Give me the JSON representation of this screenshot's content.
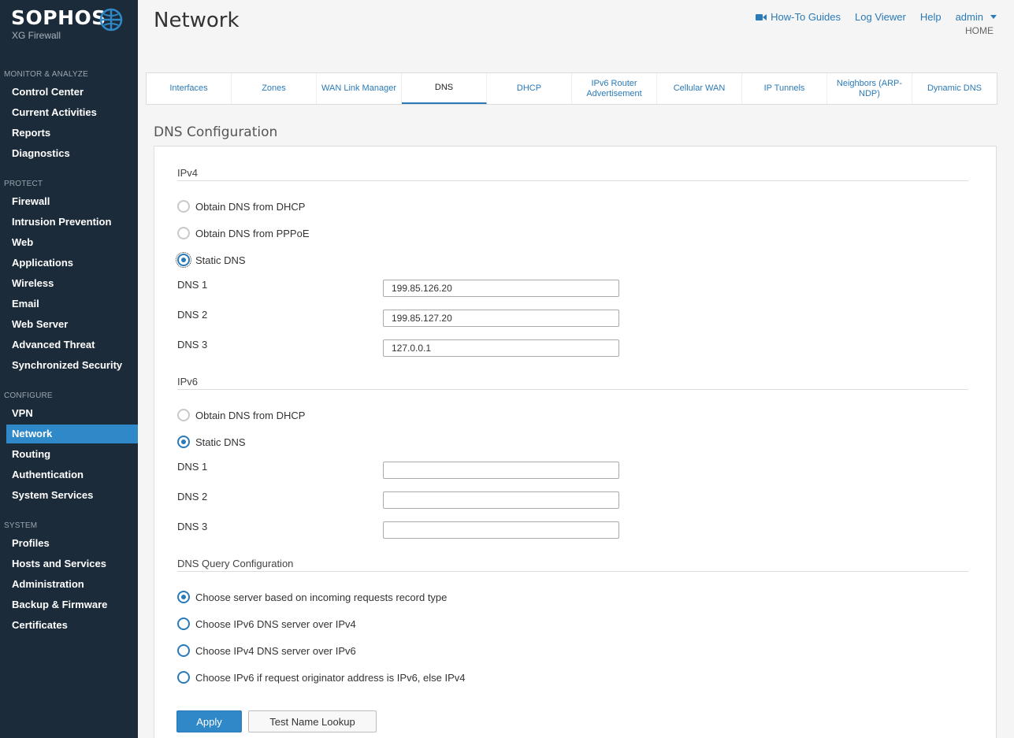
{
  "brand": {
    "name": "SOPHOS",
    "product": "XG Firewall"
  },
  "sidebar": {
    "sections": [
      {
        "label": "MONITOR & ANALYZE",
        "items": [
          "Control Center",
          "Current Activities",
          "Reports",
          "Diagnostics"
        ]
      },
      {
        "label": "PROTECT",
        "items": [
          "Firewall",
          "Intrusion Prevention",
          "Web",
          "Applications",
          "Wireless",
          "Email",
          "Web Server",
          "Advanced Threat",
          "Synchronized Security"
        ]
      },
      {
        "label": "CONFIGURE",
        "items": [
          "VPN",
          "Network",
          "Routing",
          "Authentication",
          "System Services"
        ]
      },
      {
        "label": "SYSTEM",
        "items": [
          "Profiles",
          "Hosts and Services",
          "Administration",
          "Backup & Firmware",
          "Certificates"
        ]
      }
    ],
    "active_item": "Network"
  },
  "header": {
    "title": "Network",
    "links": {
      "howto": "How-To Guides",
      "logviewer": "Log Viewer",
      "help": "Help",
      "user": "admin"
    },
    "breadcrumb": "HOME"
  },
  "tabs": [
    "Interfaces",
    "Zones",
    "WAN Link Manager",
    "DNS",
    "DHCP",
    "IPv6 Router Advertisement",
    "Cellular WAN",
    "IP Tunnels",
    "Neighbors (ARP-NDP)",
    "Dynamic DNS"
  ],
  "active_tab": "DNS",
  "dns": {
    "section_title": "DNS Configuration",
    "ipv4": {
      "title": "IPv4",
      "options": [
        "Obtain DNS from DHCP",
        "Obtain DNS from PPPoE",
        "Static DNS"
      ],
      "selected": "Static DNS",
      "fields": [
        {
          "label": "DNS 1",
          "value": "199.85.126.20"
        },
        {
          "label": "DNS 2",
          "value": "199.85.127.20"
        },
        {
          "label": "DNS 3",
          "value": "127.0.0.1"
        }
      ]
    },
    "ipv6": {
      "title": "IPv6",
      "options": [
        "Obtain DNS from DHCP",
        "Static DNS"
      ],
      "selected": "Static DNS",
      "fields": [
        {
          "label": "DNS 1",
          "value": ""
        },
        {
          "label": "DNS 2",
          "value": ""
        },
        {
          "label": "DNS 3",
          "value": ""
        }
      ]
    },
    "query": {
      "title": "DNS Query Configuration",
      "options": [
        "Choose server based on incoming requests record type",
        "Choose IPv6 DNS server over IPv4",
        "Choose IPv4 DNS server over IPv6",
        "Choose IPv6 if request originator address is IPv6, else IPv4"
      ],
      "selected": "Choose server based on incoming requests record type"
    },
    "buttons": {
      "apply": "Apply",
      "lookup": "Test Name Lookup"
    }
  },
  "colors": {
    "sidebar_bg": "#1c2b39",
    "accent": "#2f88c7",
    "link": "#2a7ab8"
  },
  "icons": {
    "logo": "globe-icon",
    "howto": "video-camera-icon",
    "user_menu": "caret-down-icon"
  }
}
